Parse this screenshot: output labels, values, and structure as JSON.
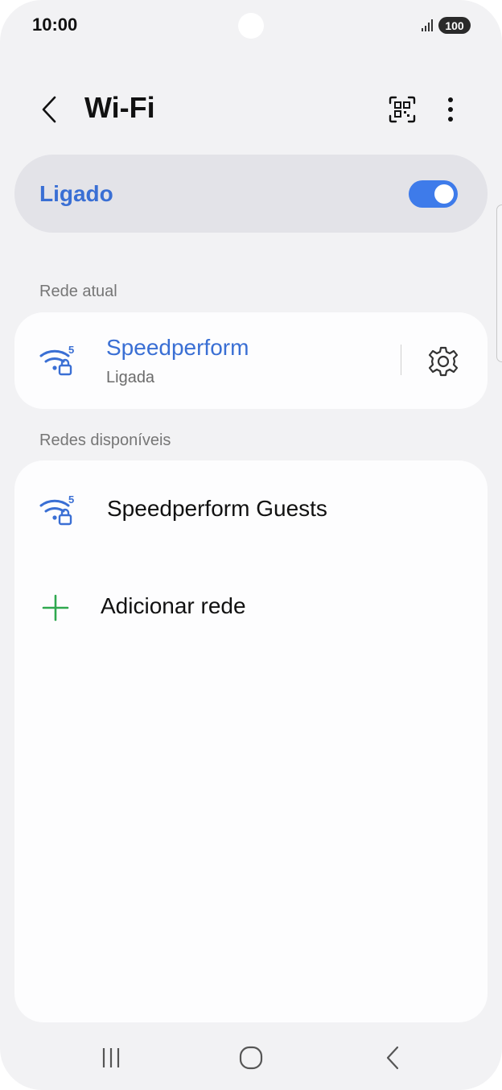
{
  "status_bar": {
    "time": "10:00",
    "battery": "100",
    "signal_icon": "signal-bars-icon"
  },
  "header": {
    "title": "Wi-Fi",
    "back_icon": "chevron-left-icon",
    "qr_icon": "qr-code-scan-icon",
    "more_icon": "more-vertical-icon"
  },
  "wifi_toggle": {
    "label": "Ligado",
    "state": true
  },
  "current_network": {
    "section_label": "Rede atual",
    "name": "Speedperform",
    "status": "Ligada",
    "band": "5",
    "icon": "wifi-secured-icon",
    "settings_icon": "gear-icon"
  },
  "available_networks": {
    "section_label": "Redes disponíveis",
    "items": [
      {
        "name": "Speedperform Guests",
        "band": "5",
        "icon": "wifi-secured-icon"
      }
    ],
    "add_network_label": "Adicionar rede",
    "add_icon": "plus-icon"
  },
  "colors": {
    "accent": "#3a6fd4",
    "toggle_on": "#3e7bea",
    "add_icon": "#2fa84f",
    "background": "#f2f2f4",
    "card": "#fdfdfe"
  },
  "nav_bar": {
    "recents_icon": "recents-icon",
    "home_icon": "home-icon",
    "back_icon": "nav-back-icon"
  }
}
